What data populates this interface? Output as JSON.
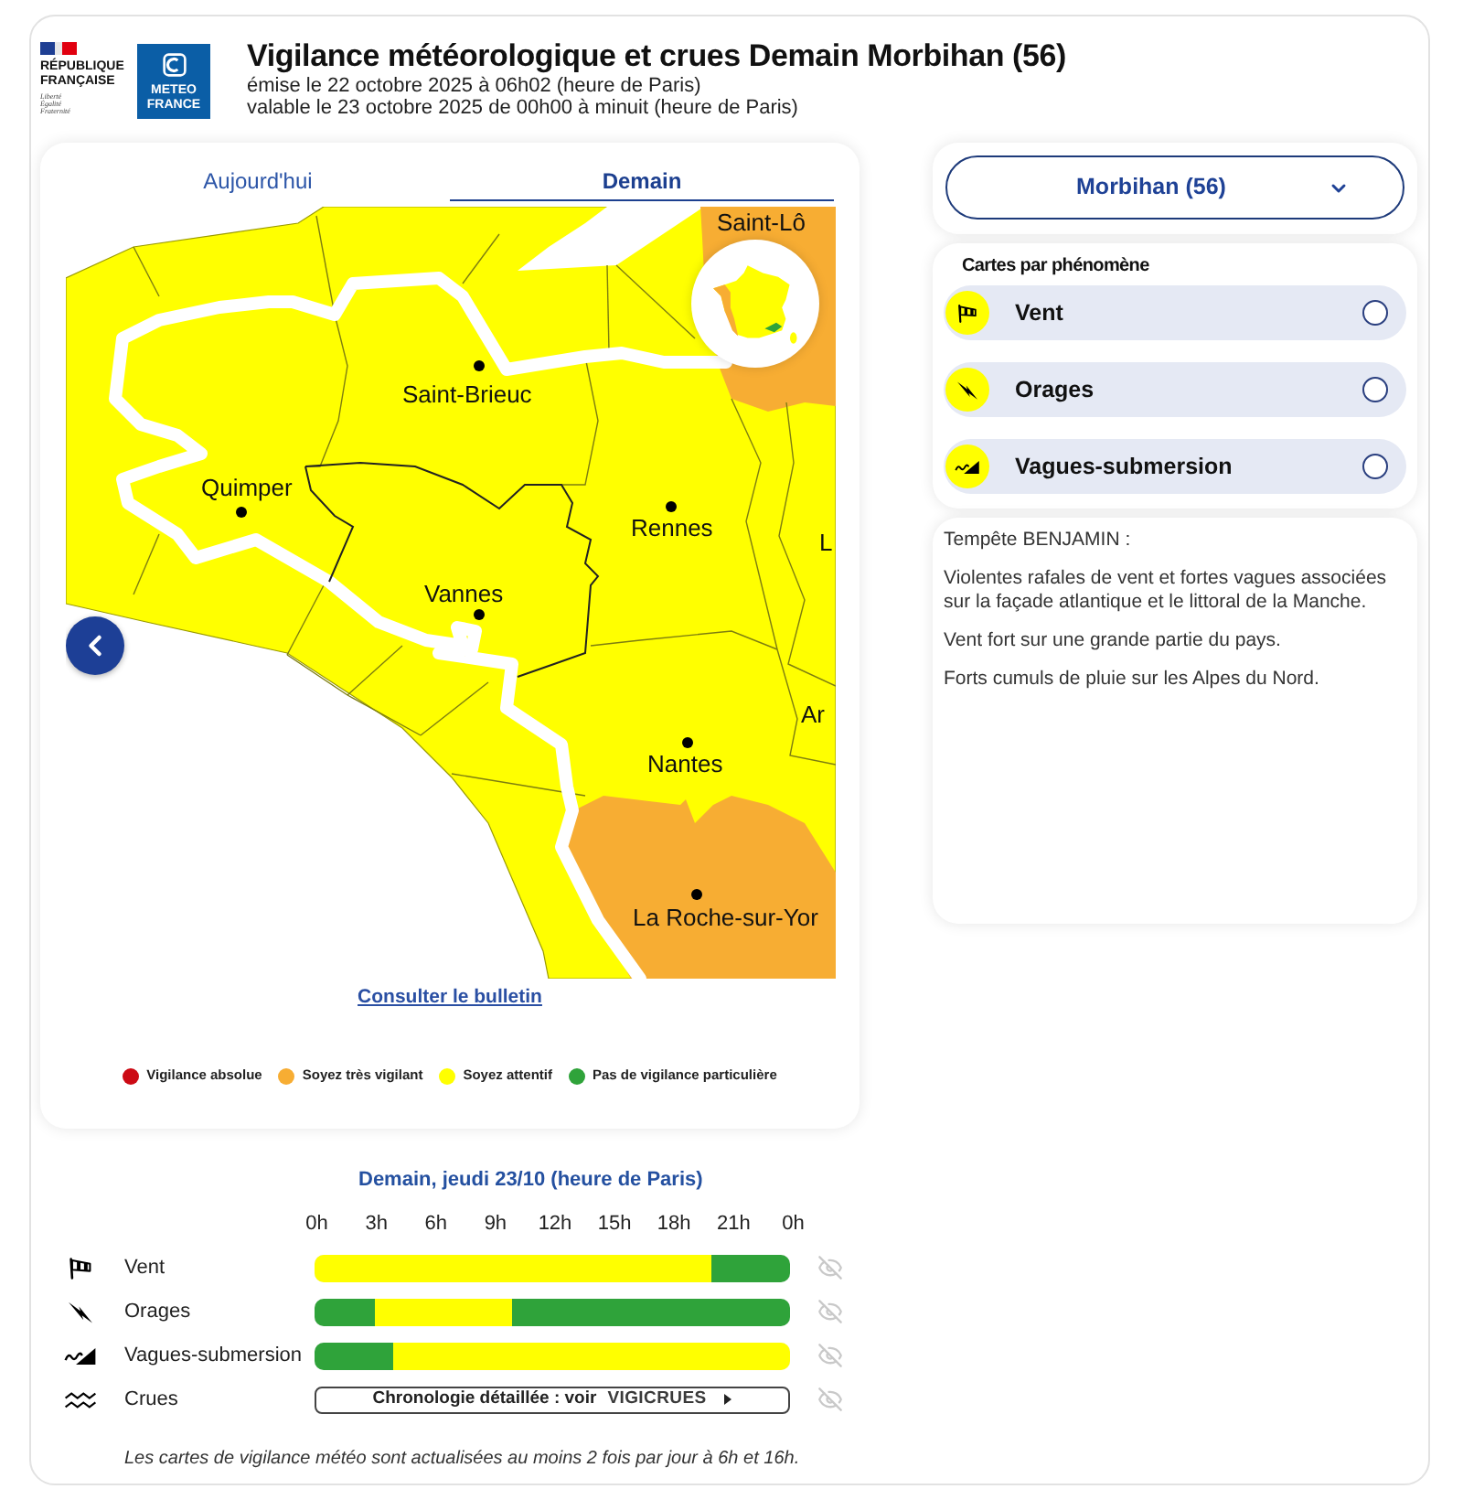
{
  "header": {
    "republic_logo": {
      "name_lines": [
        "RÉPUBLIQUE",
        "FRANÇAISE"
      ],
      "motto": [
        "Liberté",
        "Égalité",
        "Fraternité"
      ]
    },
    "agency_logo": {
      "text_lines": [
        "METEO",
        "FRANCE"
      ]
    },
    "title": "Vigilance météorologique et crues Demain Morbihan (56)",
    "issued": "émise le 22 octobre 2025 à 06h02 (heure de Paris)",
    "valid": "valable le 23 octobre 2025 de 00h00 à minuit (heure de Paris)"
  },
  "map_panel": {
    "tabs": [
      {
        "label": "Aujourd'hui",
        "selected": false
      },
      {
        "label": "Demain",
        "selected": true
      }
    ],
    "map_labels": [
      "Saint-Lô",
      "Saint-Brieuc",
      "Quimper",
      "Rennes",
      "L",
      "Vannes",
      "Ar",
      "Nantes",
      "La Roche-sur-Yor"
    ],
    "bulletin_link": "Consulter le bulletin",
    "legend": [
      {
        "label": "Vigilance absolue",
        "color": "#cc0a14"
      },
      {
        "label": "Soyez très vigilant",
        "color": "#f7ad33"
      },
      {
        "label": "Soyez attentif",
        "color": "#ffff00"
      },
      {
        "label": "Pas de vigilance particulière",
        "color": "#2fa33a"
      }
    ]
  },
  "timeline": {
    "title": "Demain, jeudi 23/10 (heure de Paris)",
    "hours": [
      "0h",
      "3h",
      "6h",
      "9h",
      "12h",
      "15h",
      "18h",
      "21h",
      "0h"
    ],
    "rows": [
      {
        "kind": "bar",
        "label": "Vent",
        "segments": [
          {
            "color": "#ffff00",
            "level": 0.8333
          },
          {
            "color": "#2fa33a",
            "level": 0.1667
          }
        ]
      },
      {
        "kind": "bar",
        "label": "Orages",
        "segments": [
          {
            "color": "#2fa33a",
            "level": 0.125
          },
          {
            "color": "#ffff00",
            "level": 0.2917
          },
          {
            "color": "#2fa33a",
            "level": 0.5833
          }
        ]
      },
      {
        "kind": "bar",
        "label": "Vagues-submersion",
        "segments": [
          {
            "color": "#2fa33a",
            "level": 0.1667
          },
          {
            "color": "#ffff00",
            "level": 0.8333
          }
        ]
      },
      {
        "kind": "link",
        "label": "Crues",
        "link_text": "Chronologie détaillée : voir",
        "brand": "VIGICRUES"
      }
    ],
    "footnote": "Les cartes de vigilance météo sont actualisées au moins 2 fois par jour à 6h et 16h."
  },
  "department_select": {
    "value": "Morbihan (56)"
  },
  "phenomena": {
    "title": "Cartes par phénomène",
    "items": [
      {
        "label": "Vent",
        "selected": false
      },
      {
        "label": "Orages",
        "selected": false
      },
      {
        "label": "Vagues-submersion",
        "selected": false
      }
    ]
  },
  "alert": {
    "title": "Tempête BENJAMIN :",
    "paragraphs": [
      "Violentes rafales de vent et fortes vagues associées sur la façade atlantique et le littoral de la Manche.",
      "Vent fort sur une grande partie du pays.",
      "Forts cumuls de pluie sur les Alpes du Nord."
    ]
  }
}
